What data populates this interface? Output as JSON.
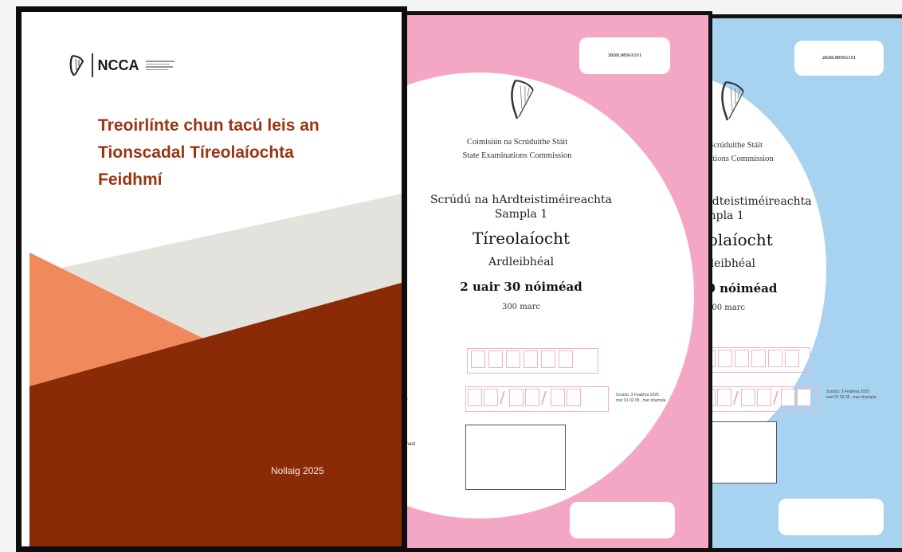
{
  "ncca_cover": {
    "logo_text": "NCCA",
    "title_lines": [
      "Treoirlínte chun tacú leis an",
      "Tionscadal Tíreolaíochta",
      "Feidhmí"
    ],
    "date": "Nollaig 2025",
    "colors": {
      "title": "#9a3412",
      "dark": "#8b2a07",
      "orange": "#f08a5d",
      "grey": "#e4e2dc"
    }
  },
  "pink_exam": {
    "code": "2026L0856A1S1",
    "commission_ga": "Coimisiún na Scrúduithe Stáit",
    "commission_en": "State Examinations Commission",
    "exam": "Scrúdú na hArdteistiméireachta",
    "sample": "Sampla 1",
    "subject": "Tíreolaíocht",
    "level": "Ardleibhéal",
    "duration": "2 uair 30 nóiméad",
    "marks": "300 marc",
    "date_note_1": "Scrúdú: 3 Feabhra 2025",
    "date_note_2": "mar 01 02 05 , mar shampla",
    "label_frag_1": "ir",
    "label_frag_2": "he",
    "label_frag_3": "ionaid",
    "color": "#f4a7c4"
  },
  "blue_exam": {
    "code": "2026L0856G1S1",
    "commission_ga": "na Scrúduithe Stáit",
    "commission_en": "ainations Commission",
    "exam": "Ardteistiméireachta",
    "sample": "ampla 1",
    "subject": "eolaíocht",
    "level": "thleibhéal",
    "duration": "30 nóiméad",
    "marks": "300 marc",
    "date_note_1": "Scrúdú: 3 Feabhra 2025",
    "date_note_2": "mar 01 02 05 , mar shampla",
    "color": "#a7d3f0"
  }
}
